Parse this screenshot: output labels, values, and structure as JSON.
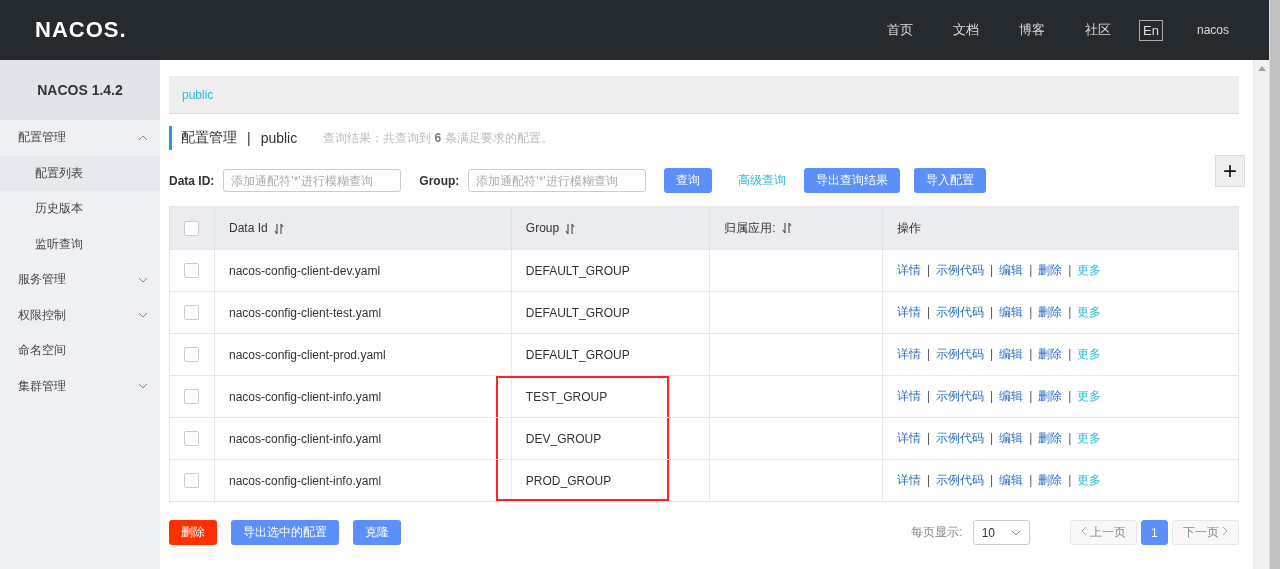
{
  "header": {
    "logo": "NACOS.",
    "nav": [
      "首页",
      "文档",
      "博客",
      "社区"
    ],
    "lang": "En",
    "user": "nacos"
  },
  "sidebar": {
    "version": "NACOS 1.4.2",
    "items": [
      {
        "label": "配置管理",
        "kind": "group",
        "expanded": true,
        "children": [
          {
            "label": "配置列表",
            "selected": true
          },
          {
            "label": "历史版本",
            "selected": false
          },
          {
            "label": "监听查询",
            "selected": false
          }
        ]
      },
      {
        "label": "服务管理",
        "kind": "group",
        "expanded": false
      },
      {
        "label": "权限控制",
        "kind": "group",
        "expanded": false
      },
      {
        "label": "命名空间",
        "kind": "link"
      },
      {
        "label": "集群管理",
        "kind": "group",
        "expanded": false
      }
    ]
  },
  "breadcrumb": "public",
  "title": {
    "text": "配置管理",
    "separator": "|",
    "namespace": "public",
    "summary": "查询结果：共查询到 **6** 条满足要求的配置。"
  },
  "filters": [
    {
      "label": "Data ID:",
      "placeholder": "添加通配符'*'进行模糊查询"
    },
    {
      "label": "Group:",
      "placeholder": "添加通配符'*'进行模糊查询"
    }
  ],
  "toolbar": [
    {
      "label": "查询",
      "kind": "primary"
    },
    {
      "label": "高级查询",
      "kind": "link"
    },
    {
      "label": "导出查询结果",
      "kind": "primary"
    },
    {
      "label": "导入配置",
      "kind": "primary"
    }
  ],
  "add_button": "+",
  "table": {
    "select_all_checked": false,
    "columns": [
      {
        "label": "Data Id",
        "sortable": true
      },
      {
        "label": "Group",
        "sortable": true
      },
      {
        "label": "归属应用:",
        "sortable": true
      },
      {
        "label": "操作",
        "sortable": false
      }
    ],
    "rows": [
      {
        "checked": false,
        "data_id": "nacos-config-client-dev.yaml",
        "group": "DEFAULT_GROUP",
        "highlighted": false,
        "actions": [
          "详情",
          "示例代码",
          "编辑",
          "删除"
        ],
        "separators": [
          "|",
          "|",
          "|",
          "|"
        ],
        "more": "更多"
      },
      {
        "checked": false,
        "data_id": "nacos-config-client-test.yaml",
        "group": "DEFAULT_GROUP",
        "highlighted": false,
        "actions": [
          "详情",
          "示例代码",
          "编辑",
          "删除"
        ],
        "separators": [
          "|",
          "|",
          "|",
          "|"
        ],
        "more": "更多"
      },
      {
        "checked": false,
        "data_id": "nacos-config-client-prod.yaml",
        "group": "DEFAULT_GROUP",
        "highlighted": false,
        "actions": [
          "详情",
          "示例代码",
          "编辑",
          "删除"
        ],
        "separators": [
          "|",
          "|",
          "|",
          "|"
        ],
        "more": "更多"
      },
      {
        "checked": false,
        "data_id": "nacos-config-client-info.yaml",
        "group": "TEST_GROUP",
        "highlighted": true,
        "actions": [
          "详情",
          "示例代码",
          "编辑",
          "删除"
        ],
        "separators": [
          "|",
          "|",
          "|",
          "|"
        ],
        "more": "更多"
      },
      {
        "checked": false,
        "data_id": "nacos-config-client-info.yaml",
        "group": "DEV_GROUP",
        "highlighted": true,
        "actions": [
          "详情",
          "示例代码",
          "编辑",
          "删除"
        ],
        "separators": [
          "|",
          "|",
          "|",
          "|"
        ],
        "more": "更多"
      },
      {
        "checked": false,
        "data_id": "nacos-config-client-info.yaml",
        "group": "PROD_GROUP",
        "highlighted": true,
        "actions": [
          "详情",
          "示例代码",
          "编辑",
          "删除"
        ],
        "separators": [
          "|",
          "|",
          "|",
          "|"
        ],
        "more": "更多"
      }
    ]
  },
  "footer_buttons": [
    {
      "label": "删除",
      "kind": "danger"
    },
    {
      "label": "导出选中的配置",
      "kind": "primary"
    },
    {
      "label": "克隆",
      "kind": "primary"
    }
  ],
  "pagination": {
    "page_size_label": "每页显示:",
    "page_size": "10",
    "prev": {
      "label": "上一页",
      "disabled": true
    },
    "pages": [
      {
        "label": "1",
        "selected": true
      }
    ],
    "next": {
      "label": "下一页",
      "disabled": true
    }
  }
}
